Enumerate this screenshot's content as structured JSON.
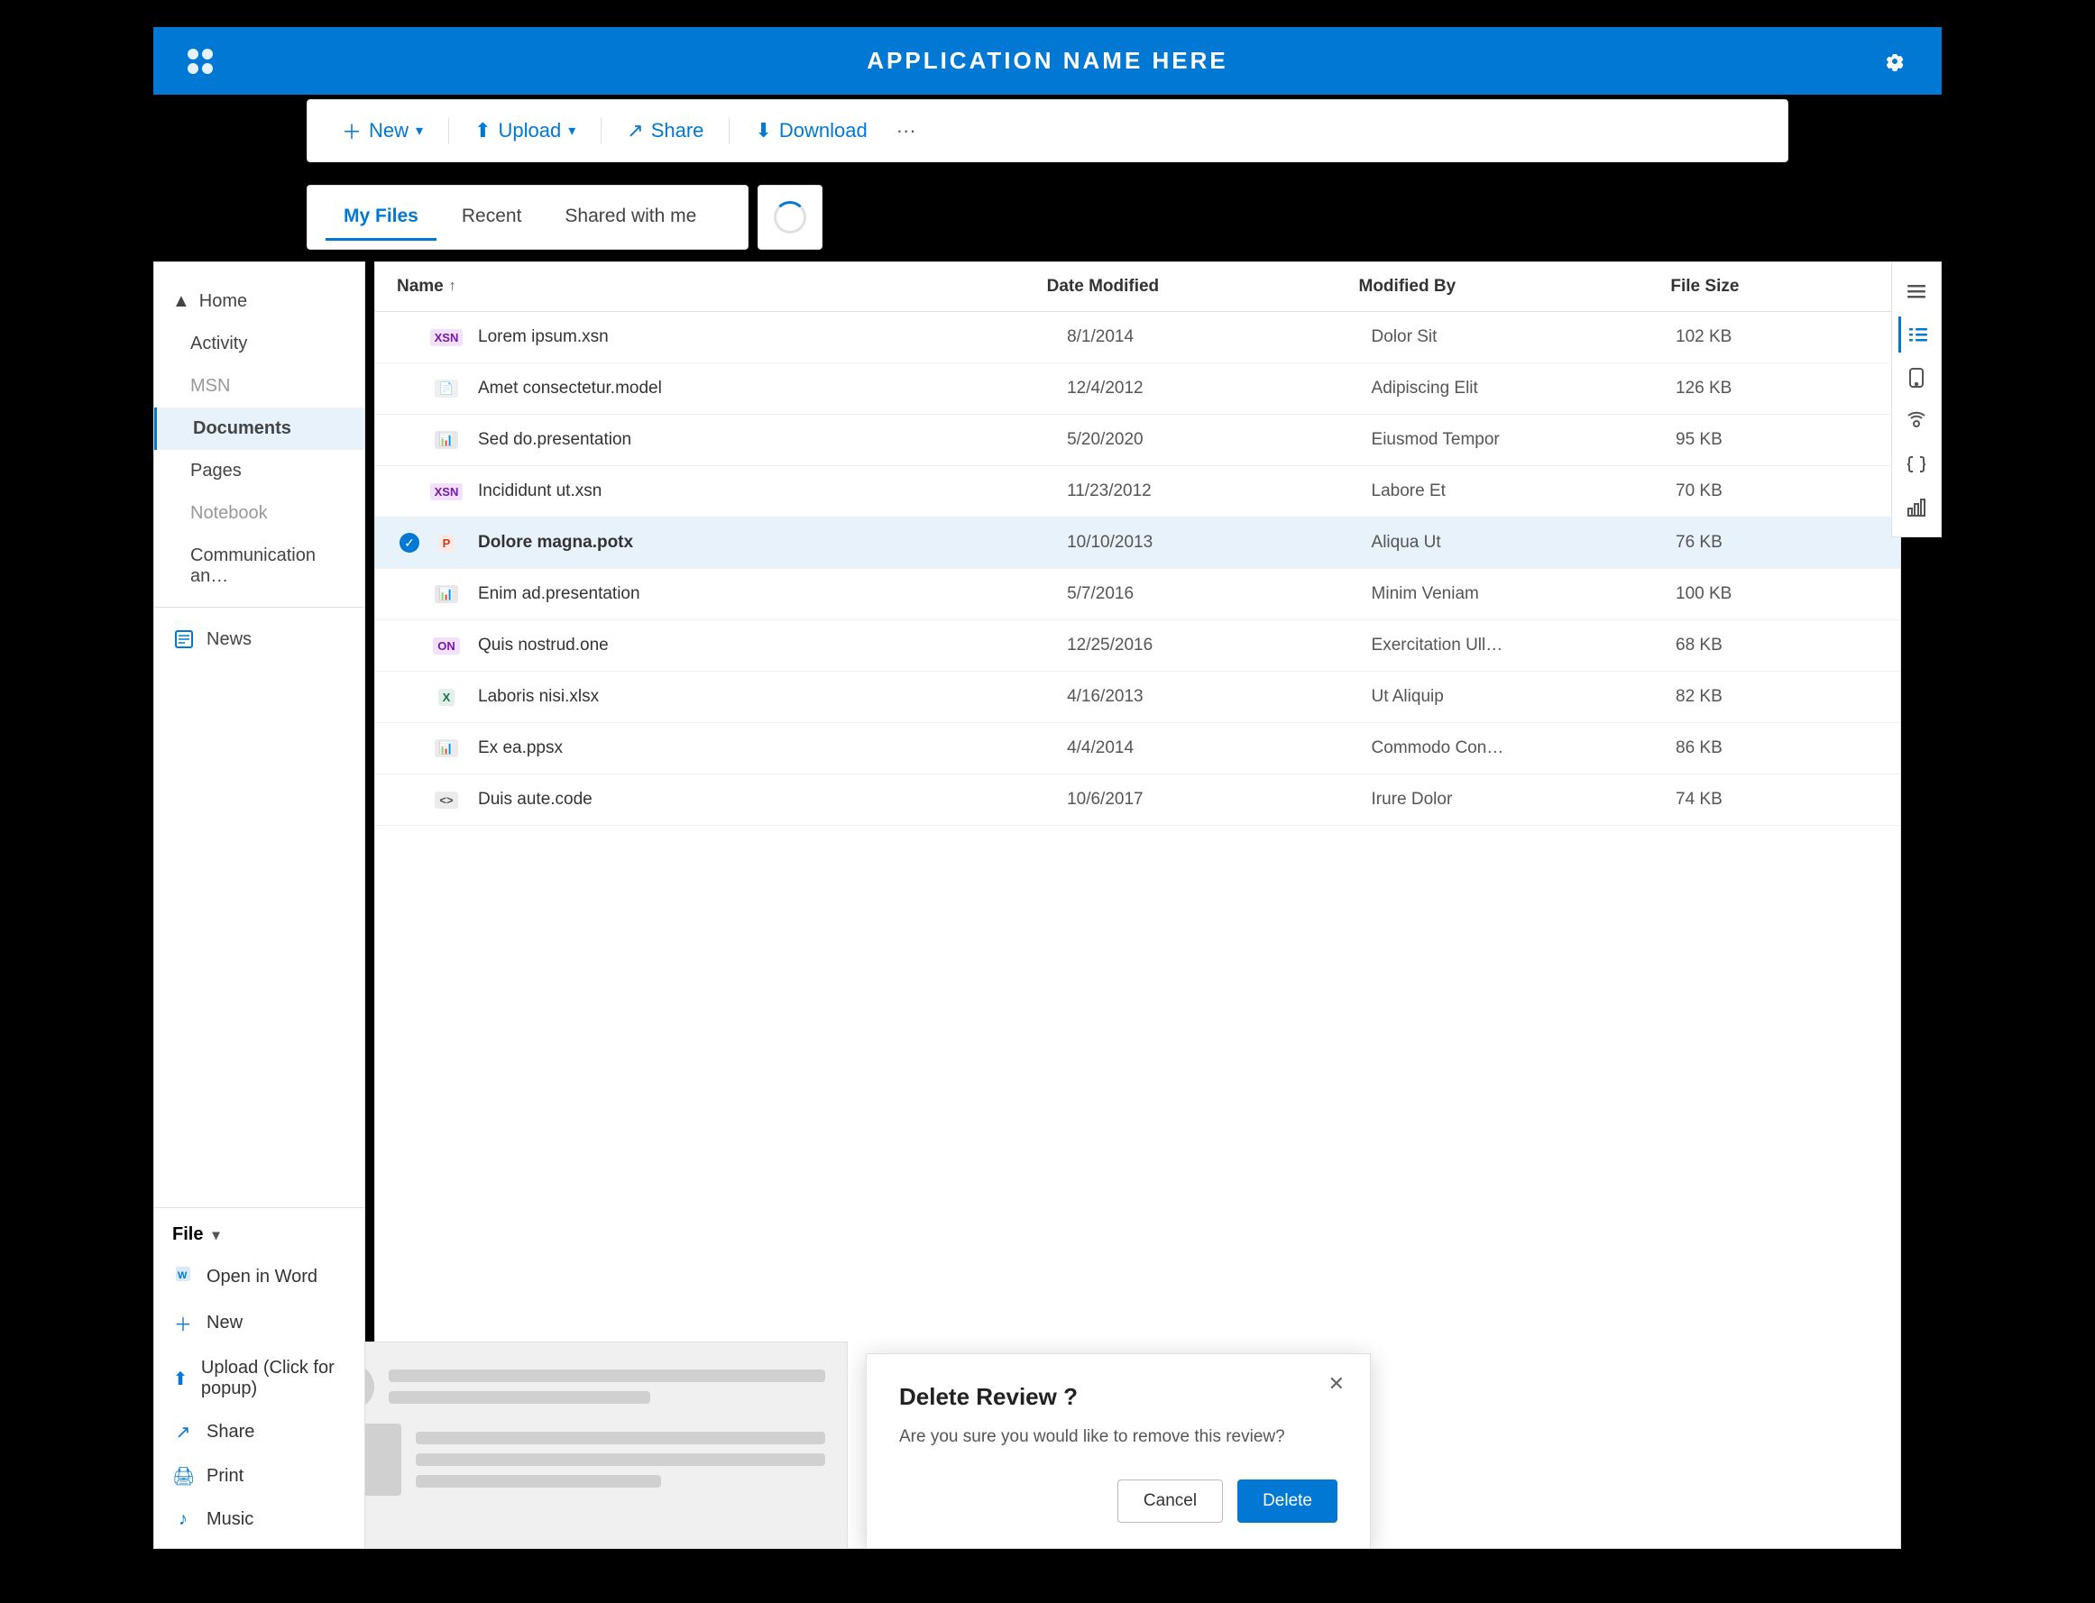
{
  "app": {
    "title": "APPLICATION NAME HERE",
    "logo_label": "app-logo",
    "settings_label": "settings"
  },
  "toolbar": {
    "new_label": "New",
    "upload_label": "Upload",
    "share_label": "Share",
    "download_label": "Download",
    "more_label": "···"
  },
  "tabs": {
    "my_files": "My Files",
    "recent": "Recent",
    "shared_with_me": "Shared with me"
  },
  "file_list": {
    "col_name": "Name",
    "sort_arrow": "↑",
    "col_date": "Date Modified",
    "col_modified": "Modified By",
    "col_size": "File Size",
    "files": [
      {
        "name": "Lorem ipsum.xsn",
        "date": "8/1/2014",
        "modified_by": "Dolor Sit",
        "size": "102 KB",
        "type": "xsn",
        "selected": false
      },
      {
        "name": "Amet consectetur.model",
        "date": "12/4/2012",
        "modified_by": "Adipiscing Elit",
        "size": "126 KB",
        "type": "model",
        "selected": false
      },
      {
        "name": "Sed do.presentation",
        "date": "5/20/2020",
        "modified_by": "Eiusmod Tempor",
        "size": "95 KB",
        "type": "pres",
        "selected": false
      },
      {
        "name": "Incididunt ut.xsn",
        "date": "11/23/2012",
        "modified_by": "Labore Et",
        "size": "70 KB",
        "type": "xsn",
        "selected": false
      },
      {
        "name": "Dolore magna.potx",
        "date": "10/10/2013",
        "modified_by": "Aliqua Ut",
        "size": "76 KB",
        "type": "pptx",
        "selected": true
      },
      {
        "name": "Enim ad.presentation",
        "date": "5/7/2016",
        "modified_by": "Minim Veniam",
        "size": "100 KB",
        "type": "pres",
        "selected": false
      },
      {
        "name": "Quis nostrud.one",
        "date": "12/25/2016",
        "modified_by": "Exercitation Ull…",
        "size": "68 KB",
        "type": "one",
        "selected": false
      },
      {
        "name": "Laboris nisi.xlsx",
        "date": "4/16/2013",
        "modified_by": "Ut Aliquip",
        "size": "82 KB",
        "type": "xlsx",
        "selected": false
      },
      {
        "name": "Ex ea.ppsx",
        "date": "4/4/2014",
        "modified_by": "Commodo Con…",
        "size": "86 KB",
        "type": "ppsx",
        "selected": false
      },
      {
        "name": "Duis aute.code",
        "date": "10/6/2017",
        "modified_by": "Irure Dolor",
        "size": "74 KB",
        "type": "code",
        "selected": false
      }
    ]
  },
  "sidebar": {
    "home_label": "Home",
    "items": [
      {
        "label": "Activity",
        "active": false,
        "muted": false
      },
      {
        "label": "MSN",
        "active": false,
        "muted": true
      },
      {
        "label": "Documents",
        "active": true,
        "muted": false
      },
      {
        "label": "Pages",
        "active": false,
        "muted": false
      },
      {
        "label": "Notebook",
        "active": false,
        "muted": true
      },
      {
        "label": "Communication an…",
        "active": false,
        "muted": false
      }
    ],
    "news_label": "News"
  },
  "context_menu": {
    "header": "File",
    "items": [
      {
        "label": "Open in Word",
        "icon": "word"
      },
      {
        "label": "New",
        "icon": "plus"
      },
      {
        "label": "Upload (Click for popup)",
        "icon": "upload"
      },
      {
        "label": "Share",
        "icon": "share"
      },
      {
        "label": "Print",
        "icon": "print"
      },
      {
        "label": "Music",
        "icon": "music"
      }
    ]
  },
  "right_toolbar": {
    "items": [
      {
        "icon": "hamburger",
        "active": false
      },
      {
        "icon": "list",
        "active": true
      },
      {
        "icon": "phone",
        "active": false
      },
      {
        "icon": "broadcast",
        "active": false
      },
      {
        "icon": "braces",
        "active": false
      },
      {
        "icon": "chart",
        "active": false
      }
    ]
  },
  "dialog": {
    "title": "Delete Review ?",
    "body": "Are you sure you would like to remove this review?",
    "cancel_label": "Cancel",
    "delete_label": "Delete"
  }
}
